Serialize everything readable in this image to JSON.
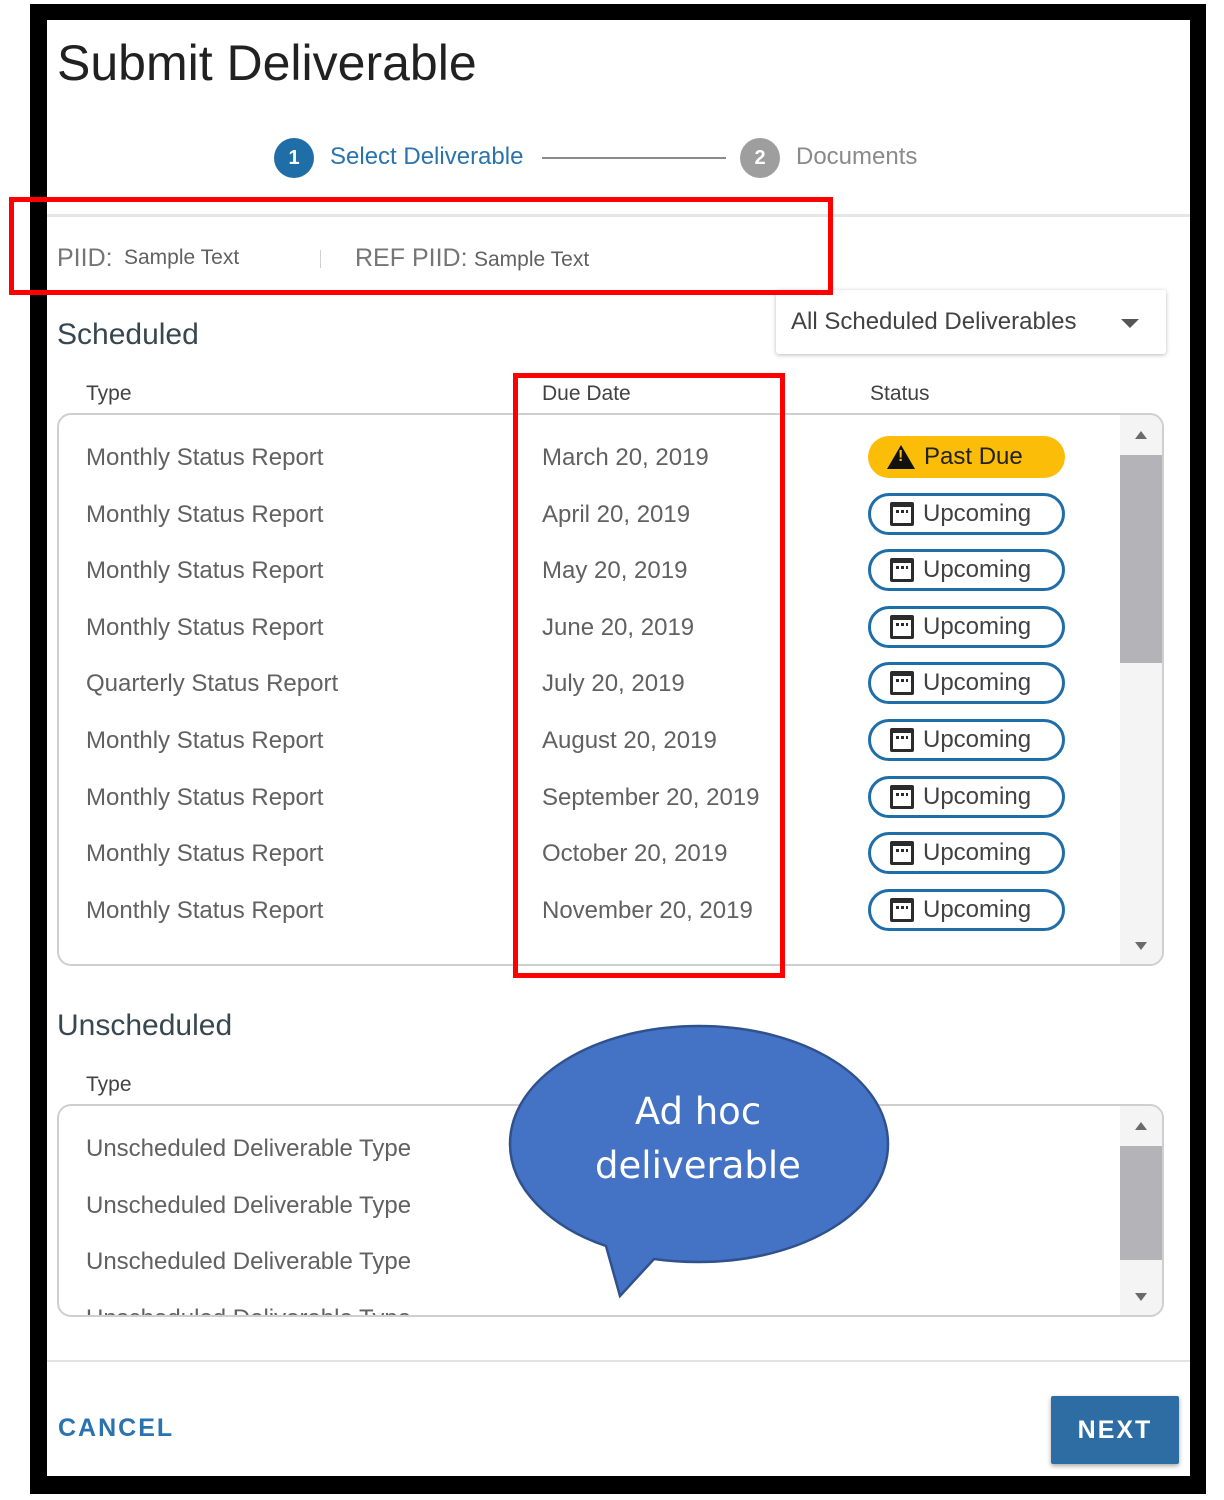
{
  "dialog": {
    "title": "Submit Deliverable"
  },
  "stepper": {
    "steps": [
      {
        "number": "1",
        "label": "Select Deliverable",
        "state": "active"
      },
      {
        "number": "2",
        "label": "Documents",
        "state": "inactive"
      }
    ]
  },
  "contract": {
    "piid_label": "PIID:",
    "piid_value": "Sample Text",
    "ref_piid_label": "REF PIID:",
    "ref_piid_value": "Sample Text"
  },
  "scheduled": {
    "title": "Scheduled",
    "filter": {
      "selected": "All Scheduled Deliverables"
    },
    "columns": {
      "type": "Type",
      "due_date": "Due Date",
      "status": "Status"
    },
    "rows": [
      {
        "type": "Monthly Status Report",
        "due": "March 20, 2019",
        "status": "Past Due",
        "status_kind": "past-due"
      },
      {
        "type": "Monthly Status Report",
        "due": "April 20, 2019",
        "status": "Upcoming",
        "status_kind": "upcoming"
      },
      {
        "type": "Monthly Status Report",
        "due": "May 20, 2019",
        "status": "Upcoming",
        "status_kind": "upcoming"
      },
      {
        "type": "Monthly Status Report",
        "due": "June 20, 2019",
        "status": "Upcoming",
        "status_kind": "upcoming"
      },
      {
        "type": "Quarterly Status Report",
        "due": "July 20, 2019",
        "status": "Upcoming",
        "status_kind": "upcoming"
      },
      {
        "type": "Monthly Status Report",
        "due": "August 20, 2019",
        "status": "Upcoming",
        "status_kind": "upcoming"
      },
      {
        "type": "Monthly Status Report",
        "due": "September 20, 2019",
        "status": "Upcoming",
        "status_kind": "upcoming"
      },
      {
        "type": "Monthly Status Report",
        "due": "October 20, 2019",
        "status": "Upcoming",
        "status_kind": "upcoming"
      },
      {
        "type": "Monthly Status Report",
        "due": "November 20, 2019",
        "status": "Upcoming",
        "status_kind": "upcoming"
      }
    ]
  },
  "unscheduled": {
    "title": "Unscheduled",
    "columns": {
      "type": "Type"
    },
    "rows": [
      {
        "type": "Unscheduled Deliverable Type"
      },
      {
        "type": "Unscheduled Deliverable Type"
      },
      {
        "type": "Unscheduled Deliverable Type"
      },
      {
        "type": "Unscheduled Deliverable Type"
      }
    ]
  },
  "callout": {
    "line1": "Ad hoc",
    "line2": "deliverable"
  },
  "footer": {
    "cancel_label": "CANCEL",
    "next_label": "NEXT"
  },
  "colors": {
    "primary": "#2a73ae",
    "past_due": "#fbbd08",
    "highlight": "#ff0000",
    "callout": "#4472c4"
  },
  "icons": {
    "past_due": "warning-icon",
    "upcoming": "calendar-icon",
    "filter": "caret-down-icon"
  }
}
